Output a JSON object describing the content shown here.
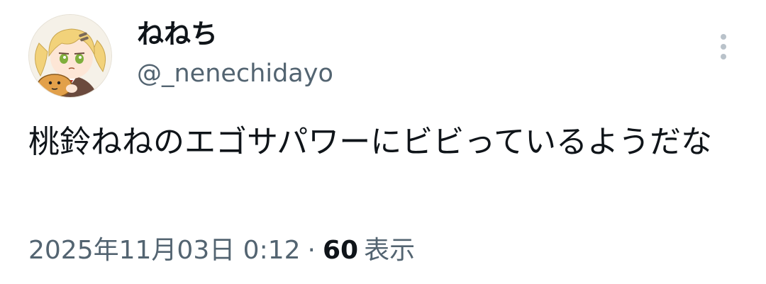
{
  "tweet": {
    "display_name": "ねねち",
    "handle": "@_nenechidayo",
    "text": "桃鈴ねねのエゴサパワーにビビっているようだな",
    "timestamp": "2025年11月03日 0:12",
    "separator": "·",
    "views_count": "60",
    "views_label": "表示"
  },
  "icons": {
    "avatar": "profile-avatar-anime-girl",
    "more": "more-vertical-icon"
  },
  "colors": {
    "primary_text": "#0f1419",
    "secondary_text": "#536471",
    "icon": "#b9c2ca"
  }
}
